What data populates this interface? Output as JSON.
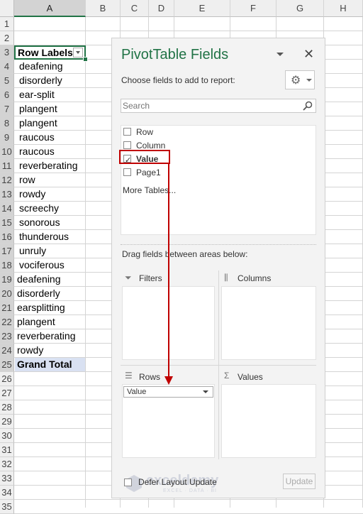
{
  "sheet": {
    "columns": [
      "A",
      "B",
      "C",
      "D",
      "E",
      "F",
      "G",
      "H"
    ],
    "row_numbers": [
      "1",
      "2",
      "3",
      "4",
      "5",
      "6",
      "7",
      "8",
      "9",
      "10",
      "11",
      "12",
      "13",
      "14",
      "15",
      "16",
      "17",
      "18",
      "19",
      "20",
      "21",
      "22",
      "23",
      "24",
      "25",
      "26",
      "27",
      "28",
      "29",
      "30",
      "31",
      "32",
      "33",
      "34",
      "35"
    ],
    "header_cell": "Row Labels",
    "values": [
      "deafening",
      "disorderly",
      "ear-split",
      "plangent",
      "plangent",
      "raucous",
      "raucous",
      "reverberating",
      "row",
      "rowdy",
      "screechy",
      "sonorous",
      "thunderous",
      "unruly",
      "vociferous",
      "deafening",
      "disorderly",
      "earsplitting",
      "plangent",
      "reverberating",
      "rowdy"
    ],
    "grand_total": "Grand Total",
    "accent_color": "#217346"
  },
  "pivot_pane": {
    "title": "PivotTable Fields",
    "choose_label": "Choose fields to add to report:",
    "search_placeholder": "Search",
    "fields": [
      {
        "label": "Row",
        "checked": false
      },
      {
        "label": "Column",
        "checked": false
      },
      {
        "label": "Value",
        "checked": true
      },
      {
        "label": "Page1",
        "checked": false
      }
    ],
    "more_tables": "More Tables...",
    "drag_text": "Drag fields between areas below:",
    "areas": {
      "filters": "Filters",
      "columns": "Columns",
      "rows": "Rows",
      "values": "Values"
    },
    "rows_field": "Value",
    "defer_label": "Defer Layout Update",
    "update_label": "Update",
    "highlight_color": "#c00000",
    "title_color": "#217346"
  },
  "watermark": {
    "name": "exceldemy",
    "sub": "EXCEL · DATA · BI"
  }
}
